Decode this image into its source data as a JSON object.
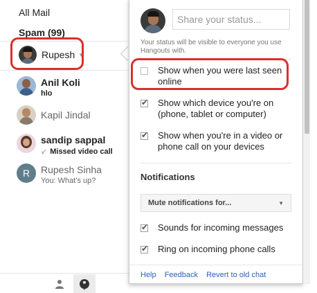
{
  "sidebar": {
    "all_mail": "All Mail",
    "spam": "Spam (99)",
    "me_name": "Rupesh"
  },
  "contacts": [
    {
      "name": "Anil Koli",
      "status": "hlo"
    },
    {
      "name": "Kapil Jindal"
    },
    {
      "name": "sandip sappal",
      "status": "Missed video call"
    },
    {
      "name": "Rupesh Sinha",
      "initial": "R",
      "status": "You: What's up?"
    }
  ],
  "popup": {
    "status_placeholder": "Share your status...",
    "hint": "Your status will be visible to everyone you use Hangouts with.",
    "options": [
      {
        "label": "Show when you were last seen online",
        "checked": false
      },
      {
        "label": "Show which device you're on (phone, tablet or computer)",
        "checked": true
      },
      {
        "label": "Show when you're in a video or phone call on your devices",
        "checked": true
      }
    ],
    "notifications_title": "Notifications",
    "mute_label": "Mute notifications for...",
    "notif_options": [
      {
        "label": "Sounds for incoming messages",
        "checked": true
      },
      {
        "label": "Ring on incoming phone calls",
        "checked": true
      }
    ],
    "links": [
      "Help",
      "Feedback",
      "Revert to old chat"
    ]
  },
  "colors": {
    "highlight": "#d9302c",
    "link": "#2962b9"
  }
}
